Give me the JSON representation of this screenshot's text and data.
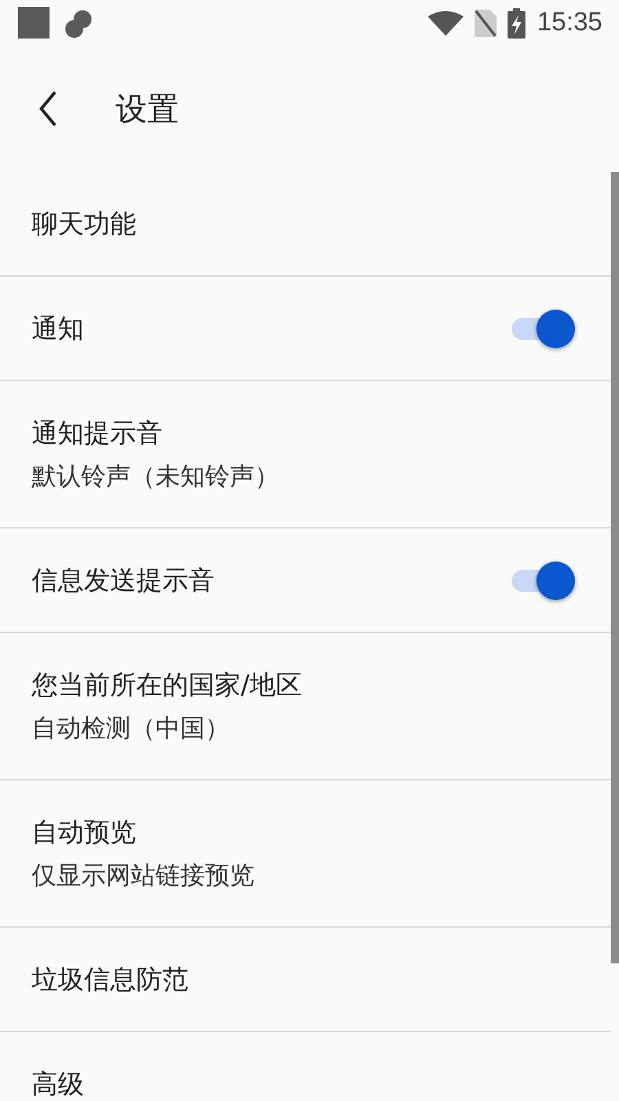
{
  "status_bar": {
    "time": "15:35"
  },
  "header": {
    "title": "设置"
  },
  "items": [
    {
      "kind": "plain",
      "title": "聊天功能"
    },
    {
      "kind": "toggle",
      "title": "通知",
      "on": true
    },
    {
      "kind": "plain",
      "title": "通知提示音",
      "summary": "默认铃声（未知铃声）"
    },
    {
      "kind": "toggle",
      "title": "信息发送提示音",
      "on": true
    },
    {
      "kind": "plain",
      "title": "您当前所在的国家/地区",
      "summary": "自动检测（中国）"
    },
    {
      "kind": "plain",
      "title": "自动预览",
      "summary": "仅显示网站链接预览"
    },
    {
      "kind": "plain",
      "title": "垃圾信息防范"
    },
    {
      "kind": "plain",
      "title": "高级"
    }
  ]
}
